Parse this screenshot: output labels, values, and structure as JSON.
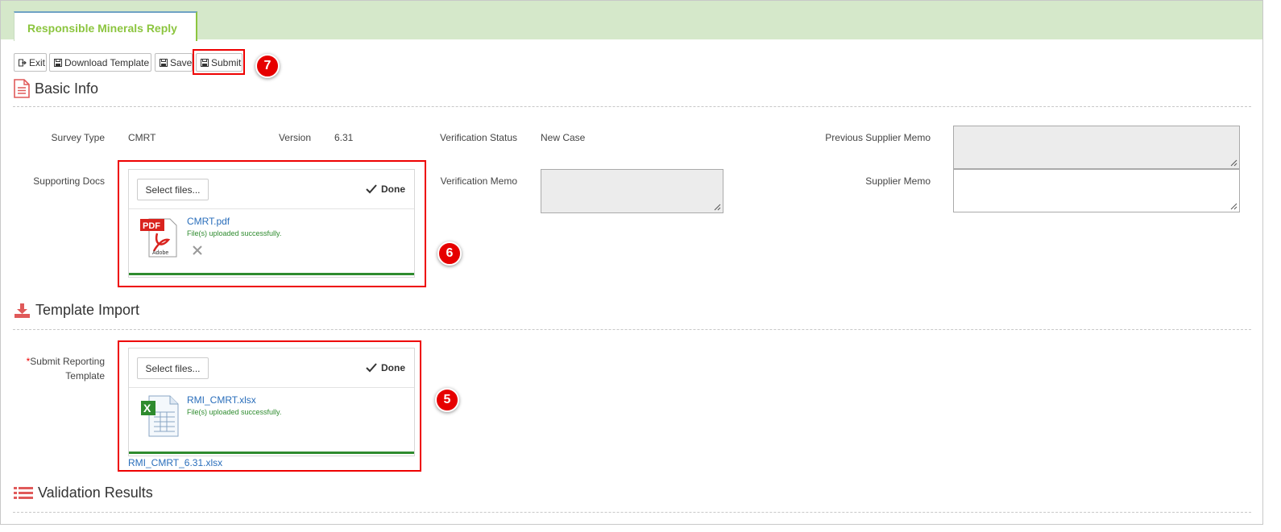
{
  "tab": {
    "label": "Responsible Minerals Reply"
  },
  "toolbar": {
    "exit_label": "Exit",
    "download_label": "Download Template",
    "save_label": "Save",
    "submit_label": "Submit"
  },
  "callouts": {
    "submit": "7",
    "supporting": "6",
    "template": "5"
  },
  "basic_info": {
    "title": "Basic Info",
    "survey_type_label": "Survey Type",
    "survey_type_value": "CMRT",
    "version_label": "Version",
    "version_value": "6.31",
    "verification_status_label": "Verification Status",
    "verification_status_value": "New Case",
    "previous_supplier_memo_label": "Previous Supplier Memo",
    "supporting_docs_label": "Supporting Docs",
    "verification_memo_label": "Verification Memo",
    "supplier_memo_label": "Supplier Memo"
  },
  "supporting_upload": {
    "select_label": "Select files...",
    "done_label": "Done",
    "file_name": "CMRT.pdf",
    "status": "File(s) uploaded successfully.",
    "icon": "pdf-file-icon"
  },
  "template_import": {
    "title": "Template Import",
    "required_mark": "*",
    "label_line1": "Submit Reporting",
    "label_line2": "Template",
    "select_label": "Select files...",
    "done_label": "Done",
    "file_name": "RMI_CMRT.xlsx",
    "status": "File(s) uploaded successfully.",
    "icon": "excel-file-icon",
    "link": "RMI_CMRT_6.31.xlsx"
  },
  "validation": {
    "title": "Validation Results"
  },
  "colors": {
    "accent_green": "#8cc53f",
    "header_band": "#d5e8ca",
    "highlight_red": "#e00000",
    "link_blue": "#2a6ebb",
    "success_green": "#2e8b2e"
  }
}
